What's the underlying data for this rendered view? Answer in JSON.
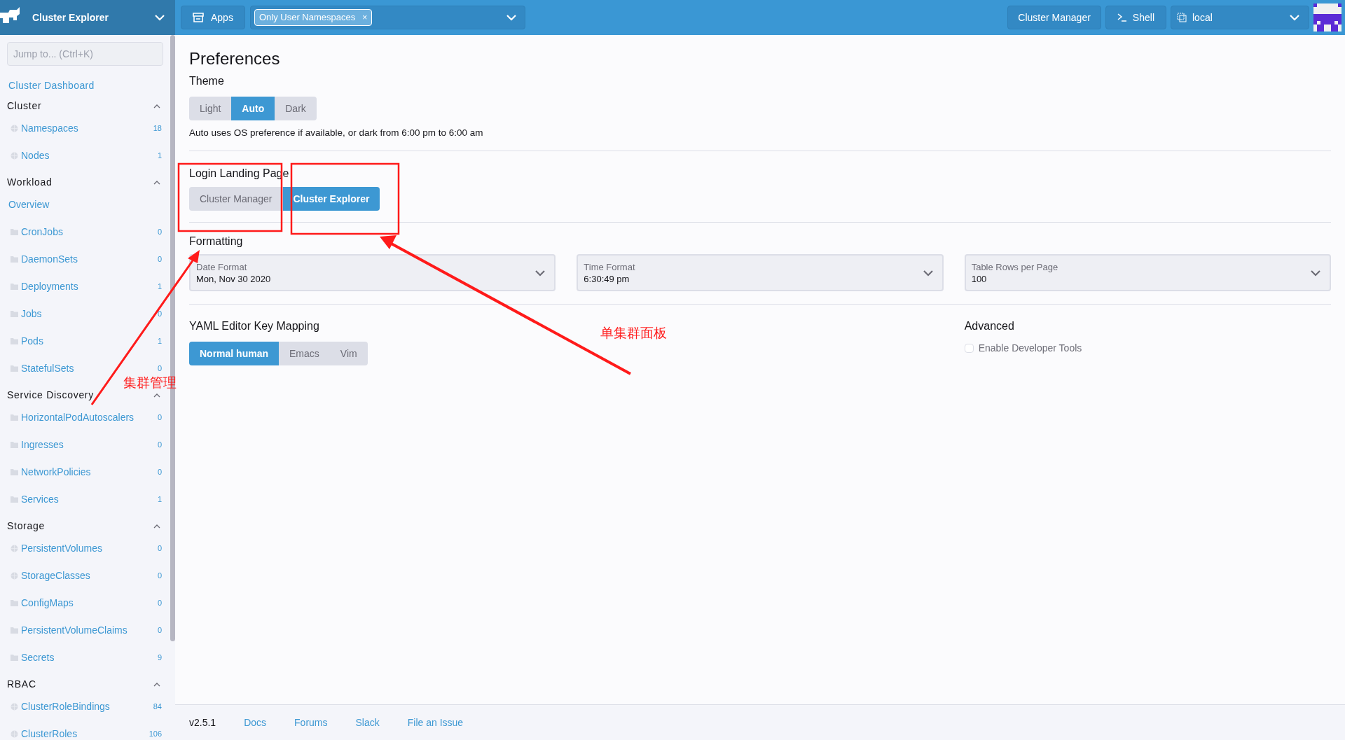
{
  "topbar": {
    "product": "Cluster Explorer",
    "apps_button": "Apps",
    "namespace_filter": {
      "tags": [
        {
          "label": "Only User Namespaces",
          "remove": "×"
        }
      ]
    },
    "cluster_manager_button": "Cluster Manager",
    "shell_button": "Shell",
    "cluster_select": "local"
  },
  "sidebar": {
    "search": {
      "placeholder": "Jump to... (Ctrl+K)"
    },
    "dashboard_link": "Cluster Dashboard",
    "groups": [
      {
        "title": "Cluster",
        "expanded": true,
        "items": [
          {
            "label": "Namespaces",
            "count": "18",
            "kind": "globe"
          },
          {
            "label": "Nodes",
            "count": "1",
            "kind": "globe"
          }
        ]
      },
      {
        "title": "Workload",
        "expanded": true,
        "items": [
          {
            "label": "Overview",
            "kind": "link"
          },
          {
            "label": "CronJobs",
            "count": "0",
            "kind": "folder"
          },
          {
            "label": "DaemonSets",
            "count": "0",
            "kind": "folder"
          },
          {
            "label": "Deployments",
            "count": "1",
            "kind": "folder"
          },
          {
            "label": "Jobs",
            "count": "0",
            "kind": "folder"
          },
          {
            "label": "Pods",
            "count": "1",
            "kind": "folder"
          },
          {
            "label": "StatefulSets",
            "count": "0",
            "kind": "folder"
          }
        ]
      },
      {
        "title": "Service Discovery",
        "expanded": true,
        "items": [
          {
            "label": "HorizontalPodAutoscalers",
            "count": "0",
            "kind": "folder"
          },
          {
            "label": "Ingresses",
            "count": "0",
            "kind": "folder"
          },
          {
            "label": "NetworkPolicies",
            "count": "0",
            "kind": "folder"
          },
          {
            "label": "Services",
            "count": "1",
            "kind": "folder"
          }
        ]
      },
      {
        "title": "Storage",
        "expanded": true,
        "items": [
          {
            "label": "PersistentVolumes",
            "count": "0",
            "kind": "globe"
          },
          {
            "label": "StorageClasses",
            "count": "0",
            "kind": "globe"
          },
          {
            "label": "ConfigMaps",
            "count": "0",
            "kind": "folder"
          },
          {
            "label": "PersistentVolumeClaims",
            "count": "0",
            "kind": "folder"
          },
          {
            "label": "Secrets",
            "count": "9",
            "kind": "folder"
          }
        ]
      },
      {
        "title": "RBAC",
        "expanded": true,
        "items": [
          {
            "label": "ClusterRoleBindings",
            "count": "84",
            "kind": "globe"
          },
          {
            "label": "ClusterRoles",
            "count": "106",
            "kind": "globe"
          }
        ]
      }
    ]
  },
  "preferences": {
    "title": "Preferences",
    "theme": {
      "label": "Theme",
      "options": [
        {
          "label": "Light",
          "selected": false
        },
        {
          "label": "Auto",
          "selected": true
        },
        {
          "label": "Dark",
          "selected": false
        }
      ],
      "note": "Auto uses OS preference if available, or dark from 6:00 pm to 6:00 am"
    },
    "landing": {
      "label": "Login Landing Page",
      "options": [
        {
          "label": "Cluster Manager",
          "selected": false
        },
        {
          "label": "Cluster Explorer",
          "selected": true
        }
      ]
    },
    "formatting": {
      "label": "Formatting",
      "selects": [
        {
          "label": "Date Format",
          "value": "Mon, Nov 30 2020"
        },
        {
          "label": "Time Format",
          "value": "6:30:49 pm"
        },
        {
          "label": "Table Rows per Page",
          "value": "100"
        }
      ]
    },
    "yaml": {
      "label": "YAML Editor Key Mapping",
      "options": [
        {
          "label": "Normal human",
          "selected": true
        },
        {
          "label": "Emacs",
          "selected": false
        },
        {
          "label": "Vim",
          "selected": false
        }
      ]
    },
    "advanced": {
      "label": "Advanced",
      "options": [
        {
          "label": "Enable Developer Tools",
          "checked": false
        }
      ]
    }
  },
  "footer": {
    "version": "v2.5.1",
    "links": [
      "Docs",
      "Forums",
      "Slack",
      "File an Issue"
    ]
  },
  "annotations": [
    {
      "text": "集群管理"
    },
    {
      "text": "单集群面板"
    }
  ]
}
